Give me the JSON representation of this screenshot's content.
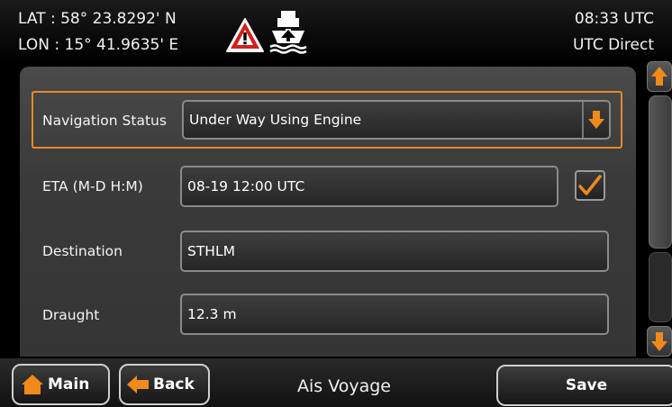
{
  "status": {
    "lat": "LAT : 58° 23.8292' N",
    "lon": "LON : 15° 41.9635' E",
    "time": "08:33 UTC",
    "utc_mode": "UTC Direct"
  },
  "icons": {
    "warning": "warning-triangle-icon",
    "ship": "ship-anchor-icon",
    "scroll_up": "arrow-up-icon",
    "scroll_down": "arrow-down-icon",
    "dropdown": "arrow-down-icon",
    "check": "check-icon",
    "home": "home-icon",
    "back": "arrow-left-icon"
  },
  "form": {
    "nav_status_label": "Navigation Status",
    "nav_status_value": "Under Way Using Engine",
    "eta_label": "ETA (M-D H:M)",
    "eta_value": "08-19 12:00 UTC",
    "eta_checked": true,
    "destination_label": "Destination",
    "destination_value": "STHLM",
    "draught_label": "Draught",
    "draught_value": "12.3 m"
  },
  "bottom": {
    "main_label": "Main",
    "back_label": "Back",
    "page_title": "Ais Voyage",
    "save_label": "Save"
  },
  "colors": {
    "accent_orange": "#f08a1c",
    "warning_red": "#d21f1f",
    "highlight_border": "#e8892a"
  }
}
